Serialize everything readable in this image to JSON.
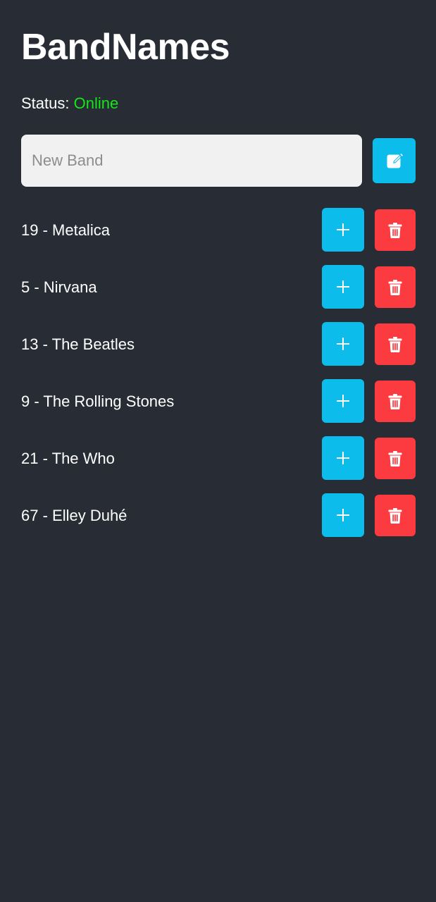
{
  "header": {
    "title": "BandNames"
  },
  "status": {
    "label": "Status:",
    "value": "Online",
    "value_color": "#15e617"
  },
  "new_band": {
    "placeholder": "New Band",
    "value": "",
    "submit_icon": "edit-icon"
  },
  "bands": [
    {
      "label": "19 - Metalica",
      "votes": 19,
      "name": "Metalica"
    },
    {
      "label": "5 - Nirvana",
      "votes": 5,
      "name": "Nirvana"
    },
    {
      "label": "13 - The Beatles",
      "votes": 13,
      "name": "The Beatles"
    },
    {
      "label": "9 - The Rolling Stones",
      "votes": 9,
      "name": "The Rolling Stones"
    },
    {
      "label": "21 - The Who",
      "votes": 21,
      "name": "The Who"
    },
    {
      "label": "67 - Elley Duhé",
      "votes": 67,
      "name": "Elley Duhé"
    }
  ],
  "row_actions": {
    "vote_icon": "plus-icon",
    "delete_icon": "trash-icon"
  },
  "colors": {
    "background": "#282c34",
    "primary": "#0cbcea",
    "danger": "#fc3b41",
    "online": "#15e617",
    "input_background": "#f1f1f1"
  }
}
